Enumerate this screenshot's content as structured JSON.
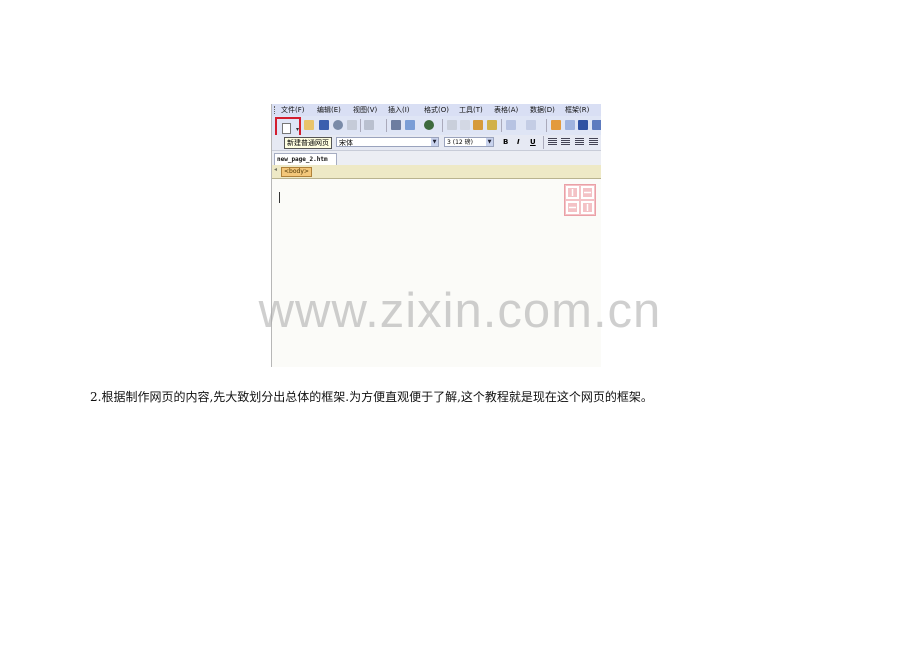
{
  "menu": [
    "文件(F)",
    "编辑(E)",
    "视图(V)",
    "插入(I)",
    "格式(O)",
    "工具(T)",
    "表格(A)",
    "数据(D)",
    "框架(R)"
  ],
  "tooltip": "新建普通网页",
  "font": {
    "name": "宋体",
    "size": "3 (12 磅)"
  },
  "format_buttons": [
    "B",
    "I",
    "U"
  ],
  "tab": "new_page_2.htm",
  "tag": "<body>",
  "watermark": "www.zixin.com.cn",
  "caption": "2.根据制作网页的内容,先大致划分出总体的框架.为方便直观便于了解,这个教程就是现在这个网页的框架。",
  "colors": {
    "highlight": "#d31e2e",
    "menubar": "#d9dff4",
    "tag": "#f3c77a"
  },
  "icons": [
    "new-page-icon",
    "open-icon",
    "save-icon",
    "search-icon",
    "print-icon",
    "preview-icon",
    "spellcheck-icon",
    "cut-icon",
    "copy-icon",
    "paste-icon",
    "format-painter-icon",
    "undo-icon",
    "redo-icon",
    "insert-table-icon",
    "frame-icon",
    "image-icon"
  ]
}
